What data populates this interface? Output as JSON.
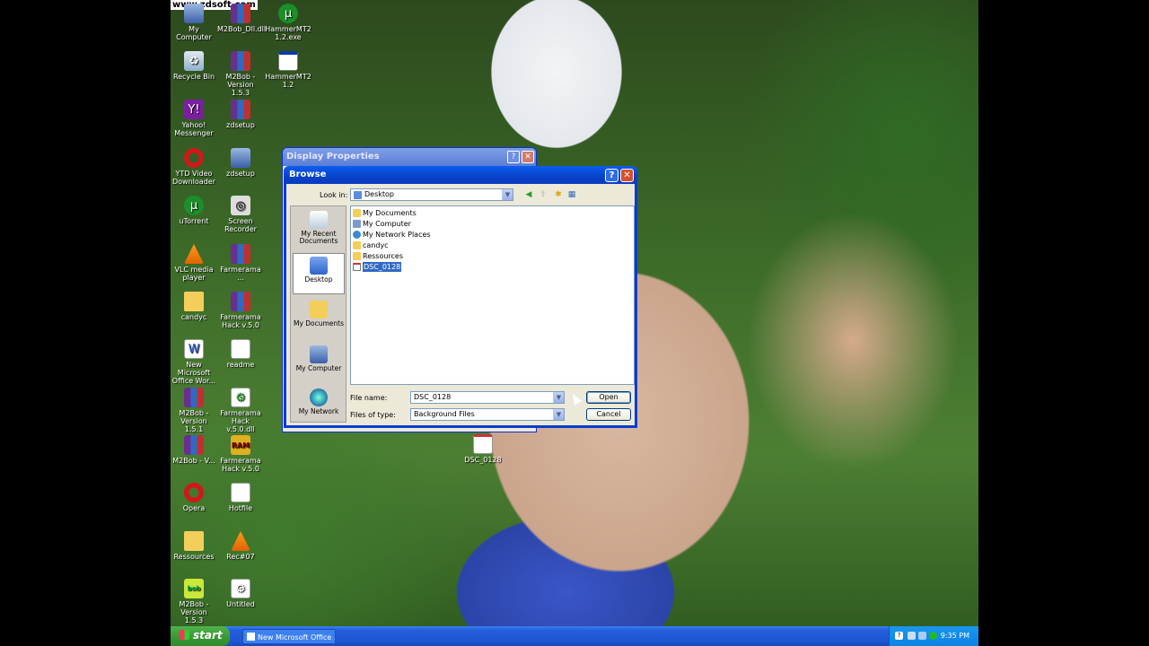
{
  "watermark": "www.zdsoft.com",
  "desktop_icons": [
    {
      "label": "My Computer",
      "icon": "computer-icon"
    },
    {
      "label": "M2Bob_Dll.dll",
      "icon": "winrar-icon"
    },
    {
      "label": "HammerMT2 1.2.exe",
      "icon": "utorrent-icon"
    },
    {
      "label": "Recycle Bin",
      "icon": "recycle-bin-icon"
    },
    {
      "label": "M2Bob - Version 1.5.3",
      "icon": "winrar-icon"
    },
    {
      "label": "HammerMT2 1.2",
      "icon": "window-icon"
    },
    {
      "label": "Yahoo! Messenger",
      "icon": "yahoo-icon"
    },
    {
      "label": "zdsetup",
      "icon": "winrar-icon"
    },
    {
      "label": "YTD Video Downloader",
      "icon": "ytd-icon"
    },
    {
      "label": "zdsetup",
      "icon": "network-computer-icon"
    },
    {
      "label": "uTorrent",
      "icon": "utorrent-icon"
    },
    {
      "label": "Screen Recorder",
      "icon": "camera-icon"
    },
    {
      "label": "VLC media player",
      "icon": "vlc-icon"
    },
    {
      "label": "Farmerama ...",
      "icon": "winrar-icon"
    },
    {
      "label": "candyc",
      "icon": "folder-icon"
    },
    {
      "label": "Farmerama Hack v.5.0",
      "icon": "winrar-icon"
    },
    {
      "label": "New Microsoft Office Wor...",
      "icon": "word-doc-icon"
    },
    {
      "label": "readme",
      "icon": "text-file-icon"
    },
    {
      "label": "M2Bob - Version 1.5.1",
      "icon": "winrar-icon"
    },
    {
      "label": "Farmerama Hack v.5.0.dll",
      "icon": "dll-icon"
    },
    {
      "label": "M2Bob - V...",
      "icon": "winrar-icon"
    },
    {
      "label": "Farmerama Hack v.5.0",
      "icon": "ram-icon"
    },
    {
      "label": "Opera",
      "icon": "opera-icon"
    },
    {
      "label": "Hotfile",
      "icon": "text-file-icon"
    },
    {
      "label": "Ressources",
      "icon": "folder-icon"
    },
    {
      "label": "Rec#07",
      "icon": "vlc-icon"
    },
    {
      "label": "M2Bob - Version 1.5.3",
      "icon": "bob-icon"
    },
    {
      "label": "Untitled",
      "icon": "settings-file-icon"
    }
  ],
  "desktop_file": {
    "label": "DSC_0128"
  },
  "display_properties": {
    "title": "Display Properties"
  },
  "browse": {
    "title": "Browse",
    "look_in_label": "Look in:",
    "look_in_value": "Desktop",
    "places": [
      "My Recent Documents",
      "Desktop",
      "My Documents",
      "My Computer",
      "My Network"
    ],
    "files": [
      {
        "name": "My Documents",
        "icon": "my-documents-icon"
      },
      {
        "name": "My Computer",
        "icon": "computer-icon"
      },
      {
        "name": "My Network Places",
        "icon": "network-icon"
      },
      {
        "name": "candyc",
        "icon": "folder-icon"
      },
      {
        "name": "Ressources",
        "icon": "folder-icon"
      },
      {
        "name": "DSC_0128",
        "icon": "image-file-icon",
        "selected": true
      }
    ],
    "file_name_label": "File name:",
    "file_name_value": "DSC_0128",
    "files_of_type_label": "Files of type:",
    "files_of_type_value": "Background Files",
    "open_label": "Open",
    "cancel_label": "Cancel"
  },
  "taskbar": {
    "start_label": "start",
    "task_label": "New Microsoft Office ...",
    "clock": "9:35 PM"
  }
}
